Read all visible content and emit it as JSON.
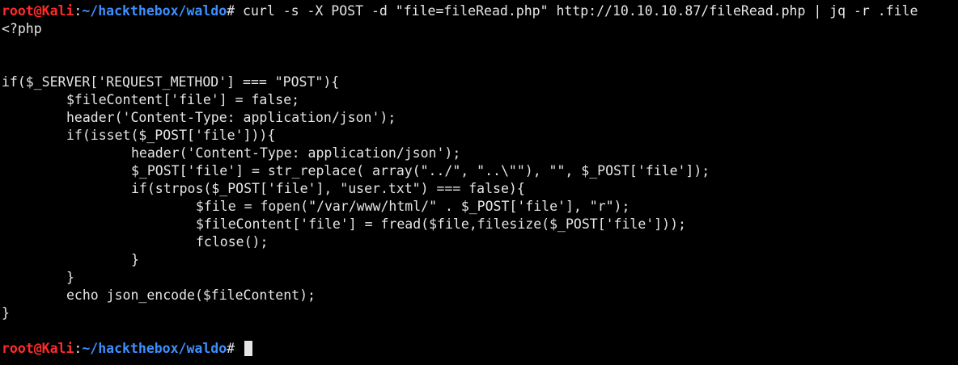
{
  "prompt": {
    "user_host": "root@Kali",
    "separator": ":",
    "path": "~/hackthebox/waldo",
    "symbol": "# "
  },
  "command": "curl -s -X POST -d \"file=fileRead.php\" http://10.10.10.87/fileRead.php | jq -r .file",
  "output": {
    "line_01": "<?php",
    "line_02": "",
    "line_03": "",
    "line_04": "if($_SERVER['REQUEST_METHOD'] === \"POST\"){",
    "line_05": "$fileContent['file'] = false;",
    "line_06": "header('Content-Type: application/json');",
    "line_07": "if(isset($_POST['file'])){",
    "line_08": "header('Content-Type: application/json');",
    "line_09": "$_POST['file'] = str_replace( array(\"../\", \"..\\\"\"), \"\", $_POST['file']);",
    "line_10": "if(strpos($_POST['file'], \"user.txt\") === false){",
    "line_11": "$file = fopen(\"/var/www/html/\" . $_POST['file'], \"r\");",
    "line_12": "$fileContent['file'] = fread($file,filesize($_POST['file']));",
    "line_13": "fclose();",
    "line_14": "}",
    "line_15": "}",
    "line_16": "echo json_encode($fileContent);",
    "line_17": "}",
    "line_18": ""
  },
  "colors": {
    "background": "#000000",
    "text": "#e6e6e6",
    "user_host": "#ff2b2b",
    "path": "#3d8fff"
  }
}
